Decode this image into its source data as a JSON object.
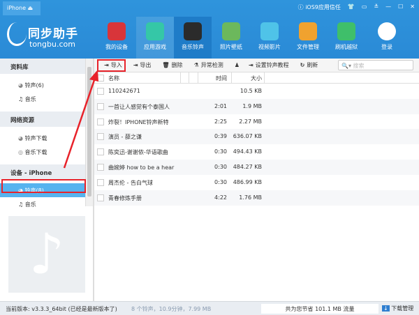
{
  "titlebar": {
    "device": "iPhone",
    "trust": "iOS9应用信任"
  },
  "logo": {
    "cn": "同步助手",
    "en": "tongbu.com"
  },
  "nav": [
    {
      "label": "我的设备",
      "color": "#d8353a"
    },
    {
      "label": "应用游戏",
      "color": "#35c7a7"
    },
    {
      "label": "音乐铃声",
      "color": "#2b2b2b"
    },
    {
      "label": "照片壁纸",
      "color": "#6cb85c"
    },
    {
      "label": "视频影片",
      "color": "#4fc3e8"
    },
    {
      "label": "文件管理",
      "color": "#f0a22f"
    },
    {
      "label": "刷机越狱",
      "color": "#3fbf6a"
    },
    {
      "label": "登录",
      "color": "#ffffff"
    }
  ],
  "toolbar": {
    "import": "导入",
    "export": "导出",
    "delete": "删除",
    "check": "异常检测",
    "tutorial": "设置铃声教程",
    "refresh": "刷新",
    "search_placeholder": "搜索"
  },
  "sidebar": {
    "library": "资料库",
    "lib_ringtones": "铃声(6)",
    "lib_music": "音乐",
    "online": "网络资源",
    "ring_download": "铃声下载",
    "music_download": "音乐下载",
    "device": "设备 - iPhone",
    "dev_ringtones": "铃声(8)",
    "dev_music": "音乐"
  },
  "table": {
    "headers": {
      "name": "名称",
      "time": "时间",
      "size": "大小"
    },
    "rows": [
      {
        "name": "110242671",
        "time": "",
        "size": "10.5 KB"
      },
      {
        "name": "一首让人感觉有个泰国人",
        "time": "2:01",
        "size": "1.9 MB"
      },
      {
        "name": "炸裂！IPHONE铃声新特",
        "time": "2:25",
        "size": "2.27 MB"
      },
      {
        "name": "演员 - 薛之谦",
        "time": "0:39",
        "size": "636.07 KB"
      },
      {
        "name": "陈奕迅-谢谢侬-华语歌曲",
        "time": "0:30",
        "size": "494.43 KB"
      },
      {
        "name": "曲婉婷 how to be a hear",
        "time": "0:30",
        "size": "484.27 KB"
      },
      {
        "name": "周杰伦 - 告白气球",
        "time": "0:30",
        "size": "486.99 KB"
      },
      {
        "name": "青春修炼手册",
        "time": "4:22",
        "size": "1.76 MB"
      }
    ]
  },
  "status": {
    "version": "当前版本: v3.3.3_64bit  (已经是最新版本了)",
    "summary": "8 个铃声，10.9分钟，7.99 MB",
    "saved": "共为您节省 101.1 MB 流量",
    "download": "下载管理"
  },
  "accent": "#2f94dc",
  "highlight": "#e8222a"
}
